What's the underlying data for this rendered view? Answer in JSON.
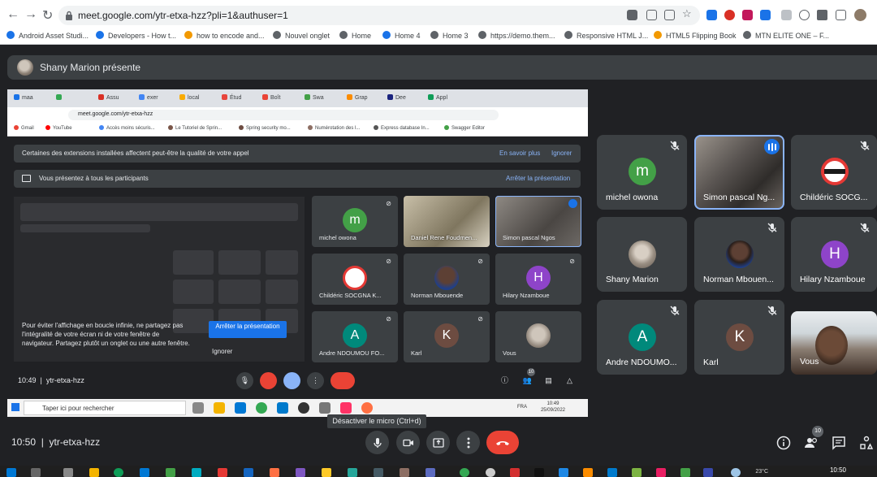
{
  "browser": {
    "url": "meet.google.com/ytr-etxa-hzz?pli=1&authuser=1",
    "bookmarks": [
      {
        "label": "Android Asset Studi...",
        "color": "#1a73e8"
      },
      {
        "label": "Developers - How t...",
        "color": "#1a73e8"
      },
      {
        "label": "how to encode and...",
        "color": "#f29900"
      },
      {
        "label": "Nouvel onglet",
        "color": "#5f6368"
      },
      {
        "label": "Home",
        "color": "#5f6368"
      },
      {
        "label": "Home 4",
        "color": "#1a73e8"
      },
      {
        "label": "Home 3",
        "color": "#5f6368"
      },
      {
        "label": "https://demo.them...",
        "color": "#5f6368"
      },
      {
        "label": "Responsive HTML J...",
        "color": "#5f6368"
      },
      {
        "label": "HTML5 Flipping Book",
        "color": "#f29900"
      },
      {
        "label": "MTN ELITE ONE – F...",
        "color": "#5f6368"
      }
    ]
  },
  "presenter": {
    "label": "Shany Marion présente"
  },
  "shared_screen": {
    "tabs": [
      "maa",
      "",
      "Assu",
      "exer",
      "local",
      "Étud",
      "Boît",
      "Swa",
      "Grap",
      "Dee",
      "Appl"
    ],
    "url": "meet.google.com/ytr-etxa-hzz",
    "bookmarks": [
      "Gmail",
      "YouTube",
      "Accès moins sécuris...",
      "Le Tutoriel de Sprin...",
      "Spring security mo...",
      "Numérotation des l...",
      "Express database In...",
      "Swagger Editor"
    ],
    "banner_extensions": "Certaines des extensions installées affectent peut-être la qualité de votre appel",
    "banner_learn": "En savoir plus",
    "banner_ignore": "Ignorer",
    "banner_presenting": "Vous présentez à tous les participants",
    "banner_stop": "Arrêter la présentation",
    "warning": "Pour éviter l'affichage en boucle infinie, ne partagez pas l'intégralité de votre écran ni de votre fenêtre de navigateur. Partagez plutôt un onglet ou une autre fenêtre.",
    "stop_button": "Arrêter la présentation",
    "ignore_button": "Ignorer",
    "time": "10:49",
    "meeting_code": "ytr-etxa-hzz",
    "participant_count": "10",
    "tiles": [
      {
        "name": "michel owona",
        "initial": "m",
        "color": "#43a047"
      },
      {
        "name": "Daniel Rene Foudmen...",
        "initial": "",
        "color": ""
      },
      {
        "name": "Simon pascal Ngos",
        "initial": "",
        "color": ""
      },
      {
        "name": "Childéric SOCGNA K...",
        "initial": "",
        "color": ""
      },
      {
        "name": "Norman Mbouende",
        "initial": "",
        "color": ""
      },
      {
        "name": "Hilary Nzamboue",
        "initial": "H",
        "color": "#8e44c9"
      },
      {
        "name": "Andre NDOUMOU FO...",
        "initial": "A",
        "color": "#00897b"
      },
      {
        "name": "Karl",
        "initial": "K",
        "color": "#6d4c41"
      },
      {
        "name": "Vous",
        "initial": "",
        "color": ""
      }
    ],
    "search_placeholder": "Taper ici pour rechercher",
    "lang": "FRA",
    "clock_time": "10:49",
    "clock_date": "25/09/2022"
  },
  "participants": [
    {
      "name": "michel owona",
      "initial": "m",
      "color": "#43a047",
      "muted": true
    },
    {
      "name": "Simon pascal Ng...",
      "initial": "",
      "color": "",
      "muted": false,
      "speaking": true
    },
    {
      "name": "Childéric SOCG...",
      "initial": "",
      "color": "",
      "muted": true
    },
    {
      "name": "Shany Marion",
      "initial": "",
      "color": "",
      "muted": false
    },
    {
      "name": "Norman Mbouen...",
      "initial": "",
      "color": "",
      "muted": true
    },
    {
      "name": "Hilary Nzamboue",
      "initial": "H",
      "color": "#8e44c9",
      "muted": true
    },
    {
      "name": "Andre NDOUMO...",
      "initial": "A",
      "color": "#00897b",
      "muted": true
    },
    {
      "name": "Karl",
      "initial": "K",
      "color": "#6d4c41",
      "muted": true
    },
    {
      "name": "Vous",
      "initial": "",
      "color": "",
      "muted": false
    }
  ],
  "meeting": {
    "time": "10:50",
    "code": "ytr-etxa-hzz",
    "participant_count": "10",
    "mic_tooltip": "Désactiver le micro (Ctrl+d)"
  },
  "taskbar": {
    "temperature": "23°C",
    "time": "10:50"
  },
  "colors": {
    "background": "#202124",
    "tile": "#3c4043",
    "end_call": "#ea4335",
    "accent": "#8ab4f8"
  }
}
